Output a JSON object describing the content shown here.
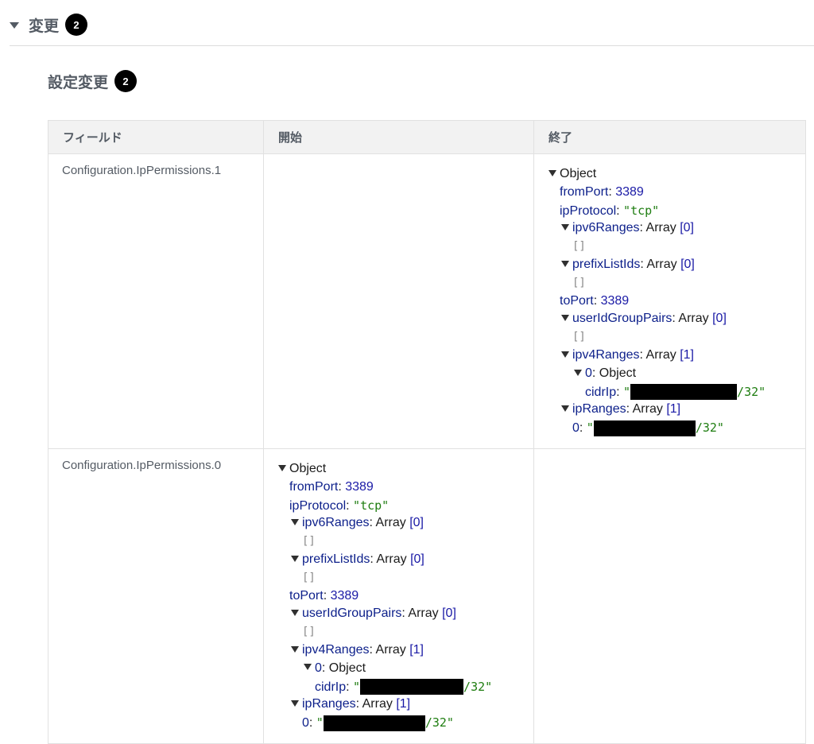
{
  "section": {
    "title": "変更",
    "count": "2"
  },
  "subsection": {
    "title": "設定変更",
    "count": "2"
  },
  "table": {
    "columns": [
      "フィールド",
      "開始",
      "終了"
    ],
    "rows": [
      {
        "field": "Configuration.IpPermissions.1",
        "start_empty": true,
        "end": {
          "root": "Object",
          "fromPort_key": "fromPort",
          "fromPort_val": "3389",
          "ipProtocol_key": "ipProtocol",
          "ipProtocol_val": "\"tcp\"",
          "ipv6Ranges_key": "ipv6Ranges",
          "ipv6Ranges_type": "Array",
          "ipv6Ranges_len": "[0]",
          "ipv6Ranges_body": "[]",
          "prefixListIds_key": "prefixListIds",
          "prefixListIds_type": "Array",
          "prefixListIds_len": "[0]",
          "prefixListIds_body": "[]",
          "toPort_key": "toPort",
          "toPort_val": "3389",
          "userIdGroupPairs_key": "userIdGroupPairs",
          "userIdGroupPairs_type": "Array",
          "userIdGroupPairs_len": "[0]",
          "userIdGroupPairs_body": "[]",
          "ipv4Ranges_key": "ipv4Ranges",
          "ipv4Ranges_type": "Array",
          "ipv4Ranges_len": "[1]",
          "item0_key": "0",
          "item0_type": "Object",
          "cidrIp_key": "cidrIp",
          "cidrIp_prefix": "\"",
          "cidrIp_suffix": "/32\"",
          "ipRanges_key": "ipRanges",
          "ipRanges_type": "Array",
          "ipRanges_len": "[1]",
          "ipRanges0_key": "0",
          "ipRanges0_prefix": "\"",
          "ipRanges0_suffix": "/32\""
        }
      },
      {
        "field": "Configuration.IpPermissions.0",
        "start": {
          "root": "Object",
          "fromPort_key": "fromPort",
          "fromPort_val": "3389",
          "ipProtocol_key": "ipProtocol",
          "ipProtocol_val": "\"tcp\"",
          "ipv6Ranges_key": "ipv6Ranges",
          "ipv6Ranges_type": "Array",
          "ipv6Ranges_len": "[0]",
          "ipv6Ranges_body": "[]",
          "prefixListIds_key": "prefixListIds",
          "prefixListIds_type": "Array",
          "prefixListIds_len": "[0]",
          "prefixListIds_body": "[]",
          "toPort_key": "toPort",
          "toPort_val": "3389",
          "userIdGroupPairs_key": "userIdGroupPairs",
          "userIdGroupPairs_type": "Array",
          "userIdGroupPairs_len": "[0]",
          "userIdGroupPairs_body": "[]",
          "ipv4Ranges_key": "ipv4Ranges",
          "ipv4Ranges_type": "Array",
          "ipv4Ranges_len": "[1]",
          "item0_key": "0",
          "item0_type": "Object",
          "cidrIp_key": "cidrIp",
          "cidrIp_prefix": "\"",
          "cidrIp_suffix": "/32\"",
          "ipRanges_key": "ipRanges",
          "ipRanges_type": "Array",
          "ipRanges_len": "[1]",
          "ipRanges0_key": "0",
          "ipRanges0_prefix": "\"",
          "ipRanges0_suffix": "/32\""
        },
        "end_empty": true
      }
    ]
  },
  "colors": {
    "key": "#0c1f8a",
    "number": "#1a1aa6",
    "string": "#1e7d10",
    "badge": "#000000",
    "header_bg": "#f2f2f2"
  }
}
